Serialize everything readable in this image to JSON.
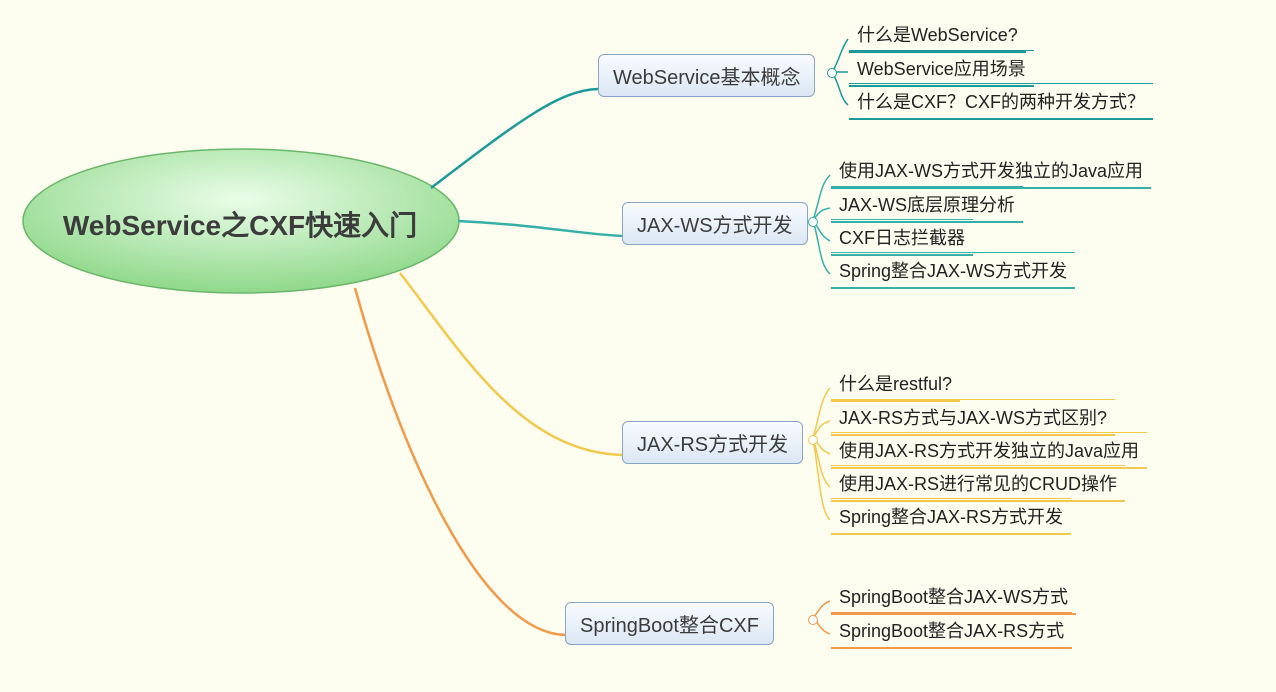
{
  "root": {
    "title": "WebService之CXF快速入门"
  },
  "branches": [
    {
      "label": "WebService基本概念",
      "leaves": [
        "什么是WebService?",
        "WebService应用场景",
        "什么是CXF？CXF的两种开发方式？"
      ]
    },
    {
      "label": "JAX-WS方式开发",
      "leaves": [
        "使用JAX-WS方式开发独立的Java应用",
        "JAX-WS底层原理分析",
        "CXF日志拦截器",
        "Spring整合JAX-WS方式开发"
      ]
    },
    {
      "label": "JAX-RS方式开发",
      "leaves": [
        "什么是restful?",
        "JAX-RS方式与JAX-WS方式区别?",
        "使用JAX-RS方式开发独立的Java应用",
        "使用JAX-RS进行常见的CRUD操作",
        "Spring整合JAX-RS方式开发"
      ]
    },
    {
      "label": "SpringBoot整合CXF",
      "leaves": [
        "SpringBoot整合JAX-WS方式",
        "SpringBoot整合JAX-RS方式"
      ]
    }
  ],
  "colors": {
    "branch1": "#1c9a9a",
    "branch2": "#34b0a8",
    "branch3": "#f2c94c",
    "branch4": "#f2994a"
  }
}
